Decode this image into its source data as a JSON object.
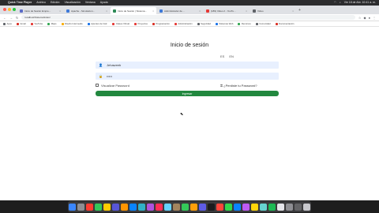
{
  "menubar": {
    "app_name": "Quick Time Player",
    "items": [
      "Archivo",
      "Edición",
      "Visualización",
      "Ventana",
      "Ayuda"
    ],
    "clock": "Vie 18 de Abr. 10:41 a. m."
  },
  "tabs": [
    {
      "label": "Inicio de Sesión Empre...",
      "fav": "#5b6cc7",
      "active": false
    },
    {
      "label": "Apache - Simulacion...",
      "fav": "#3f7ad8",
      "active": false
    },
    {
      "label": "Inicio de Sesión | Sistema...",
      "fav": "#2e8b57",
      "active": true
    },
    {
      "label": "Administrador de ...",
      "fav": "#3f7ad8",
      "active": false
    },
    {
      "label": "(189) Video 2 - YouTu...",
      "fav": "#e53935",
      "active": false
    },
    {
      "label": "Video",
      "fav": "#5f6368",
      "active": false
    }
  ],
  "address": {
    "url": "localhost/Sistema/index/",
    "icons": [
      "star-icon",
      "extension-icon",
      "profile-icon",
      "menu-icon"
    ]
  },
  "bookmarks": [
    {
      "label": "Apps",
      "color": "#5f6368"
    },
    {
      "label": "Gmail",
      "color": "#d93025"
    },
    {
      "label": "YouTube",
      "color": "#e53935"
    },
    {
      "label": "Maps",
      "color": "#34a853"
    },
    {
      "label": "Diseño Intermedio",
      "color": "#f9ab00"
    },
    {
      "label": "Apuntes de Instr.",
      "color": "#1a73e8"
    },
    {
      "label": "Clases Virtual",
      "color": "#e53935"
    },
    {
      "label": "Proyectos",
      "color": "#e53935"
    },
    {
      "label": "Programación",
      "color": "#d93025"
    },
    {
      "label": "Administración",
      "color": "#e53935"
    },
    {
      "label": "Seguridad",
      "color": "#5f6368"
    },
    {
      "label": "Sistemas Web",
      "color": "#1a73e8"
    },
    {
      "label": "Recursos",
      "color": "#34a853"
    },
    {
      "label": "Comunidad",
      "color": "#5f6368"
    },
    {
      "label": "Documentación",
      "color": "#d93025"
    }
  ],
  "login": {
    "title": "Inicio de sesión",
    "lang_es": "ES",
    "lang_en": "EN",
    "username_value": "Jehaweeb",
    "password_value": "•••••",
    "show_password": "Visualizar Password",
    "forgot": "¿Perdiste tu Password?",
    "submit": "Ingresar"
  },
  "dock_colors": [
    "#3a86ff",
    "#8e8e93",
    "#ff3b30",
    "#34c759",
    "#ffcc00",
    "#5856d6",
    "#ff9500",
    "#0a84ff",
    "#30b0c7",
    "#af52de",
    "#ff2d55",
    "#64d2ff",
    "#a2845e",
    "#34c759",
    "#ff9f0a",
    "#5e5ce6",
    "#1c1c1e",
    "#ff453a",
    "#32d74b",
    "#0a84ff",
    "#bf5af2",
    "#ffd60a",
    "#66d4cf",
    "#1db954",
    "#e5e5ea",
    "#8e8e93",
    "#636366",
    "#c7c7cc"
  ]
}
